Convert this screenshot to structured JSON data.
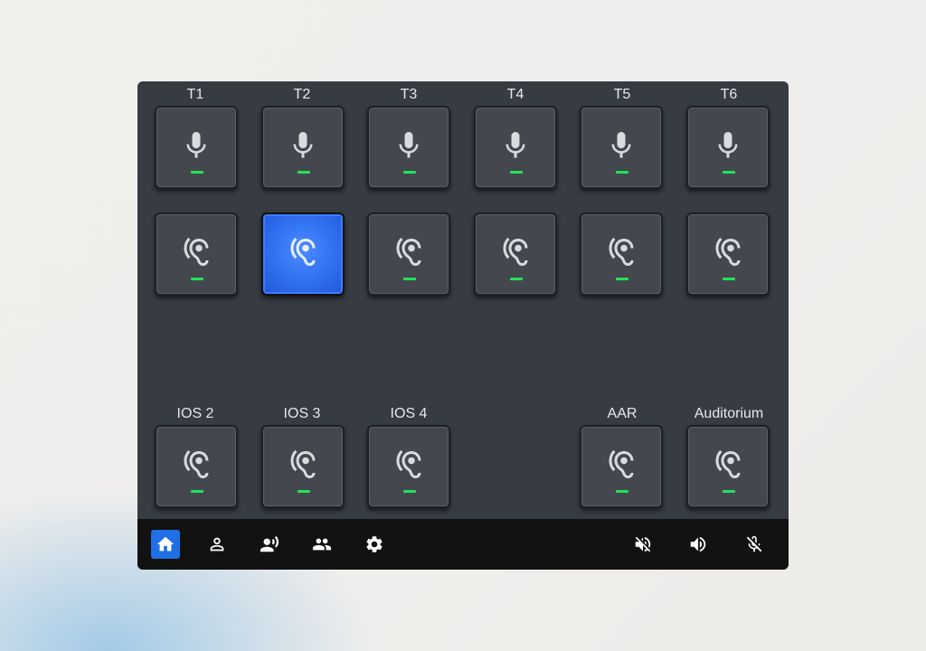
{
  "colors": {
    "panel": "#373c43",
    "tile": "#44484e",
    "active_tile": "#2f6ff0",
    "led": "#22e35a",
    "bottom_bar": "#121212",
    "active_nav": "#1f6fe5"
  },
  "talk_row": [
    {
      "label": "T1",
      "icon": "microphone-icon",
      "active": false
    },
    {
      "label": "T2",
      "icon": "microphone-icon",
      "active": false
    },
    {
      "label": "T3",
      "icon": "microphone-icon",
      "active": false
    },
    {
      "label": "T4",
      "icon": "microphone-icon",
      "active": false
    },
    {
      "label": "T5",
      "icon": "microphone-icon",
      "active": false
    },
    {
      "label": "T6",
      "icon": "microphone-icon",
      "active": false
    }
  ],
  "listen_row": [
    {
      "icon": "ear-listen-icon",
      "active": false
    },
    {
      "icon": "ear-listen-icon",
      "active": true
    },
    {
      "icon": "ear-listen-icon",
      "active": false
    },
    {
      "icon": "ear-listen-icon",
      "active": false
    },
    {
      "icon": "ear-listen-icon",
      "active": false
    },
    {
      "icon": "ear-listen-icon",
      "active": false
    }
  ],
  "bottom_row": [
    {
      "label": "IOS 2",
      "icon": "ear-listen-icon",
      "active": false
    },
    {
      "label": "IOS 3",
      "icon": "ear-listen-icon",
      "active": false
    },
    {
      "label": "IOS 4",
      "icon": "ear-listen-icon",
      "active": false
    },
    {
      "label": "AAR",
      "icon": "ear-listen-icon",
      "active": false
    },
    {
      "label": "Auditorium",
      "icon": "ear-listen-icon",
      "active": false
    }
  ],
  "nav": {
    "left": [
      {
        "icon": "home-icon",
        "active": true
      },
      {
        "icon": "person-icon",
        "active": false
      },
      {
        "icon": "speaker-person-icon",
        "active": false
      },
      {
        "icon": "group-icon",
        "active": false
      },
      {
        "icon": "gear-icon",
        "active": false
      }
    ],
    "right": [
      {
        "icon": "speaker-mute-icon"
      },
      {
        "icon": "speaker-volume-icon"
      },
      {
        "icon": "mic-off-icon"
      }
    ]
  }
}
